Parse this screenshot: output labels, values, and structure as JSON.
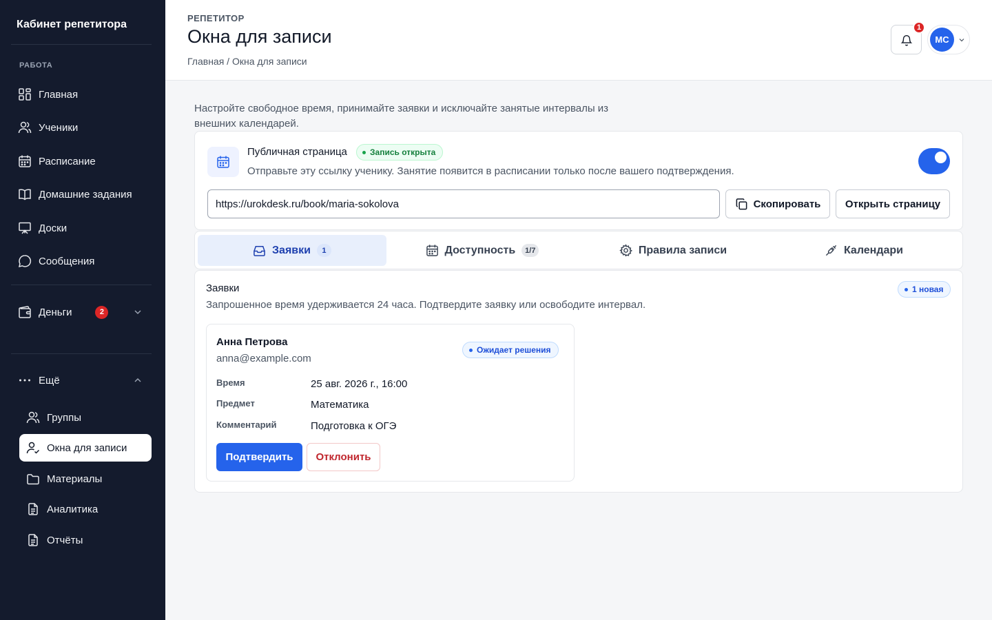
{
  "sidebar": {
    "brand": "Кабинет репетитора",
    "section_label": "РАБОТА",
    "items": [
      {
        "label": "Главная",
        "icon": "dashboard-icon"
      },
      {
        "label": "Ученики",
        "icon": "users-icon"
      },
      {
        "label": "Расписание",
        "icon": "calendar-icon"
      },
      {
        "label": "Домашние задания",
        "icon": "book-icon"
      },
      {
        "label": "Доски",
        "icon": "board-icon"
      },
      {
        "label": "Сообщения",
        "icon": "chat-icon"
      }
    ],
    "money": {
      "label": "Деньги",
      "badge": "2",
      "icon": "wallet-icon"
    },
    "more": {
      "label": "Ещё",
      "icon": "more-icon"
    },
    "sub_items": [
      {
        "label": "Группы",
        "icon": "users-icon"
      },
      {
        "label": "Окна для записи",
        "icon": "user-check-icon",
        "active": true
      },
      {
        "label": "Материалы",
        "icon": "folder-icon"
      },
      {
        "label": "Аналитика",
        "icon": "document-icon"
      },
      {
        "label": "Отчёты",
        "icon": "document-icon"
      }
    ]
  },
  "header": {
    "eyebrow": "РЕПЕТИТОР",
    "title": "Окна для записи",
    "breadcrumb": "Главная / Окна для записи",
    "notifications_count": "1",
    "avatar_initials": "МС"
  },
  "intro": "Настройте свободное время, принимайте заявки и исключайте занятые интервалы из внешних календарей.",
  "public_page": {
    "title": "Публичная страница",
    "status": "Запись открыта",
    "description": "Отправьте эту ссылку ученику. Занятие появится в расписании только после вашего подтверждения.",
    "url": "https://urokdesk.ru/book/maria-sokolova",
    "copy_label": "Скопировать",
    "open_label": "Открыть страницу",
    "enabled": true
  },
  "tabs": [
    {
      "label": "Заявки",
      "count": "1",
      "icon": "inbox-icon",
      "active": true
    },
    {
      "label": "Доступность",
      "count": "1/7",
      "icon": "calendar-icon"
    },
    {
      "label": "Правила записи",
      "icon": "gear-icon"
    },
    {
      "label": "Календари",
      "icon": "plug-icon"
    }
  ],
  "requests": {
    "title": "Заявки",
    "description": "Запрошенное время удерживается 24 часа. Подтвердите заявку или освободите интервал.",
    "new_badge": "1 новая",
    "item": {
      "name": "Анна Петрова",
      "email": "anna@example.com",
      "status": "Ожидает решения",
      "fields": [
        {
          "label": "Время",
          "value": "25 авг. 2026 г., 16:00"
        },
        {
          "label": "Предмет",
          "value": "Математика"
        },
        {
          "label": "Комментарий",
          "value": "Подготовка к ОГЭ"
        }
      ],
      "confirm_label": "Подтвердить",
      "reject_label": "Отклонить"
    }
  },
  "colors": {
    "sidebar_bg": "#141b2d",
    "accent": "#2563eb",
    "success": "#15803d",
    "danger": "#c0262d"
  }
}
